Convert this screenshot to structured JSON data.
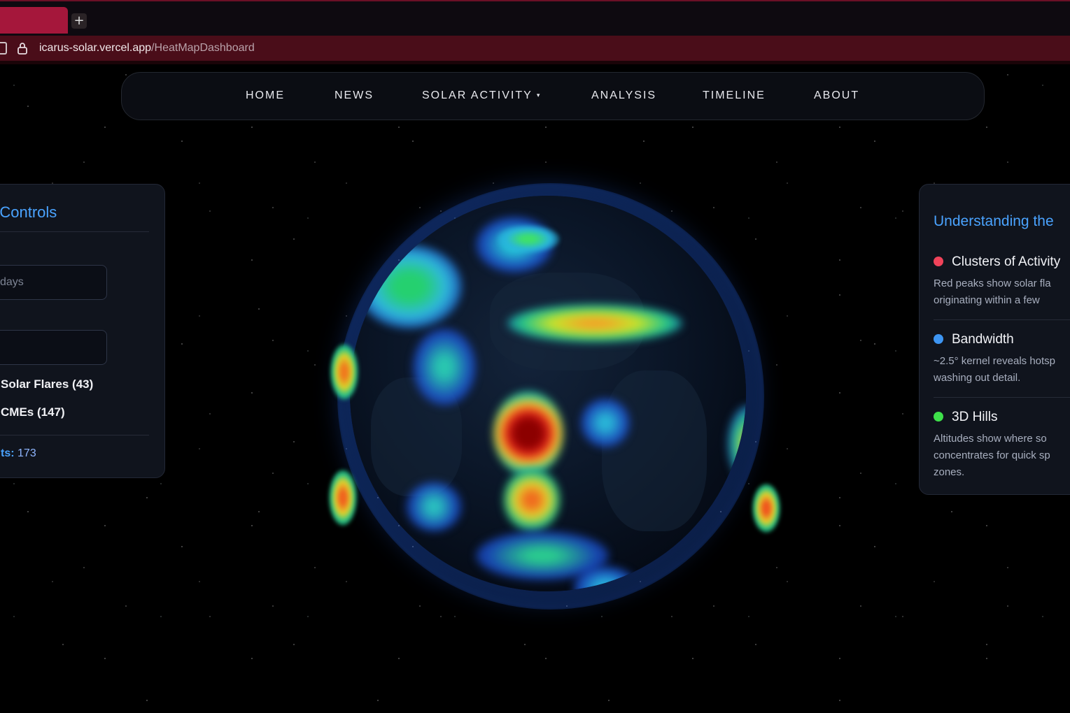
{
  "browser": {
    "url_domain": "icarus-solar.vercel.app",
    "url_path": "/HeatMapDashboard",
    "new_tab_label": "+"
  },
  "nav": {
    "items": [
      {
        "label": "HOME"
      },
      {
        "label": "NEWS"
      },
      {
        "label": "SOLAR ACTIVITY"
      },
      {
        "label": "ANALYSIS"
      },
      {
        "label": "TIMELINE"
      },
      {
        "label": "ABOUT"
      }
    ],
    "dropdown_caret": "▾"
  },
  "left_panel": {
    "title": "p Controls",
    "range_input_value": "days",
    "second_input_value": "",
    "checkboxes": [
      {
        "label": "Solar Flares (43)"
      },
      {
        "label": "CMEs (147)"
      }
    ],
    "total_label": "ts:",
    "total_value": "173"
  },
  "right_panel": {
    "title": "Understanding the",
    "items": [
      {
        "title": "Clusters of Activity",
        "color": "#f0435a",
        "text_line1": "Red peaks show solar fla",
        "text_line2": "originating within a few"
      },
      {
        "title": "Bandwidth",
        "color": "#3d95f2",
        "text_line1": "~2.5° kernel reveals hotsp",
        "text_line2": "washing out detail."
      },
      {
        "title": "3D Hills",
        "color": "#3ee04a",
        "text_line1": "Altitudes show where so",
        "text_line2": "concentrates for quick sp",
        "text_line3": "zones."
      }
    ]
  },
  "colors": {
    "accent": "#4aa3ff",
    "tab_active": "#a5173b",
    "address_bar": "#4a0d19"
  }
}
